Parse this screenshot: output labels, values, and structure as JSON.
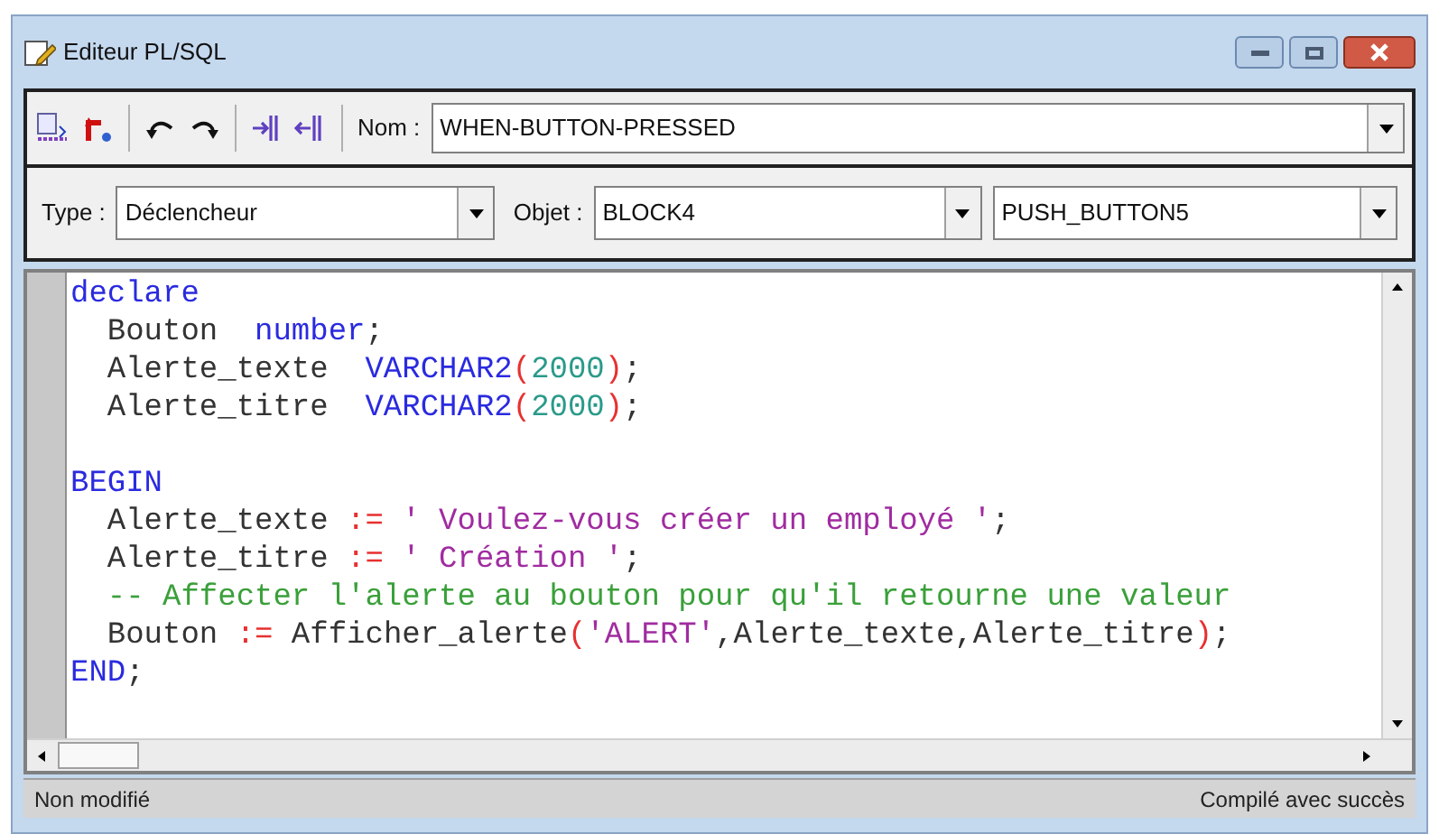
{
  "window": {
    "title": "Editeur PL/SQL"
  },
  "toolbar": {
    "name_label": "Nom :",
    "name_value": "WHEN-BUTTON-PRESSED"
  },
  "selectors": {
    "type_label": "Type :",
    "type_value": "Déclencheur",
    "object_label": "Objet :",
    "object_value": "BLOCK4",
    "item_value": "PUSH_BUTTON5"
  },
  "code_sections": [
    {
      "lines": [
        [
          {
            "text": "declare",
            "kind": "keyword"
          }
        ],
        [
          {
            "text": "  Bouton  ",
            "kind": "plain"
          },
          {
            "text": "number",
            "kind": "keyword"
          },
          {
            "text": ";",
            "kind": "plain"
          }
        ],
        [
          {
            "text": "  Alerte_texte  ",
            "kind": "plain"
          },
          {
            "text": "VARCHAR2",
            "kind": "keyword"
          },
          {
            "text": "(",
            "kind": "operator"
          },
          {
            "text": "2000",
            "kind": "number"
          },
          {
            "text": ")",
            "kind": "operator"
          },
          {
            "text": ";",
            "kind": "plain"
          }
        ],
        [
          {
            "text": "  Alerte_titre  ",
            "kind": "plain"
          },
          {
            "text": "VARCHAR2",
            "kind": "keyword"
          },
          {
            "text": "(",
            "kind": "operator"
          },
          {
            "text": "2000",
            "kind": "number"
          },
          {
            "text": ")",
            "kind": "operator"
          },
          {
            "text": ";",
            "kind": "plain"
          }
        ]
      ]
    },
    {
      "lines": [
        [
          {
            "text": "BEGIN",
            "kind": "keyword"
          }
        ],
        [
          {
            "text": "  Alerte_texte ",
            "kind": "plain"
          },
          {
            "text": ":=",
            "kind": "operator"
          },
          {
            "text": " ' Voulez-vous créer un employé '",
            "kind": "string"
          },
          {
            "text": ";",
            "kind": "plain"
          }
        ],
        [
          {
            "text": "  Alerte_titre ",
            "kind": "plain"
          },
          {
            "text": ":=",
            "kind": "operator"
          },
          {
            "text": " ' Création '",
            "kind": "string"
          },
          {
            "text": ";",
            "kind": "plain"
          }
        ],
        [
          {
            "text": "  -- Affecter l'alerte au bouton pour qu'il retourne une valeur",
            "kind": "comment"
          }
        ],
        [
          {
            "text": "  Bouton ",
            "kind": "plain"
          },
          {
            "text": ":=",
            "kind": "operator"
          },
          {
            "text": " Afficher_alerte",
            "kind": "plain"
          },
          {
            "text": "(",
            "kind": "operator"
          },
          {
            "text": "'ALERT'",
            "kind": "string"
          },
          {
            "text": ",Alerte_texte,Alerte_titre",
            "kind": "plain"
          },
          {
            "text": ")",
            "kind": "operator"
          },
          {
            "text": ";",
            "kind": "plain"
          }
        ],
        [
          {
            "text": "END",
            "kind": "keyword"
          },
          {
            "text": ";",
            "kind": "plain"
          }
        ]
      ]
    }
  ],
  "status_bar": {
    "left": "Non modifié",
    "right": "Compilé avec succès"
  }
}
